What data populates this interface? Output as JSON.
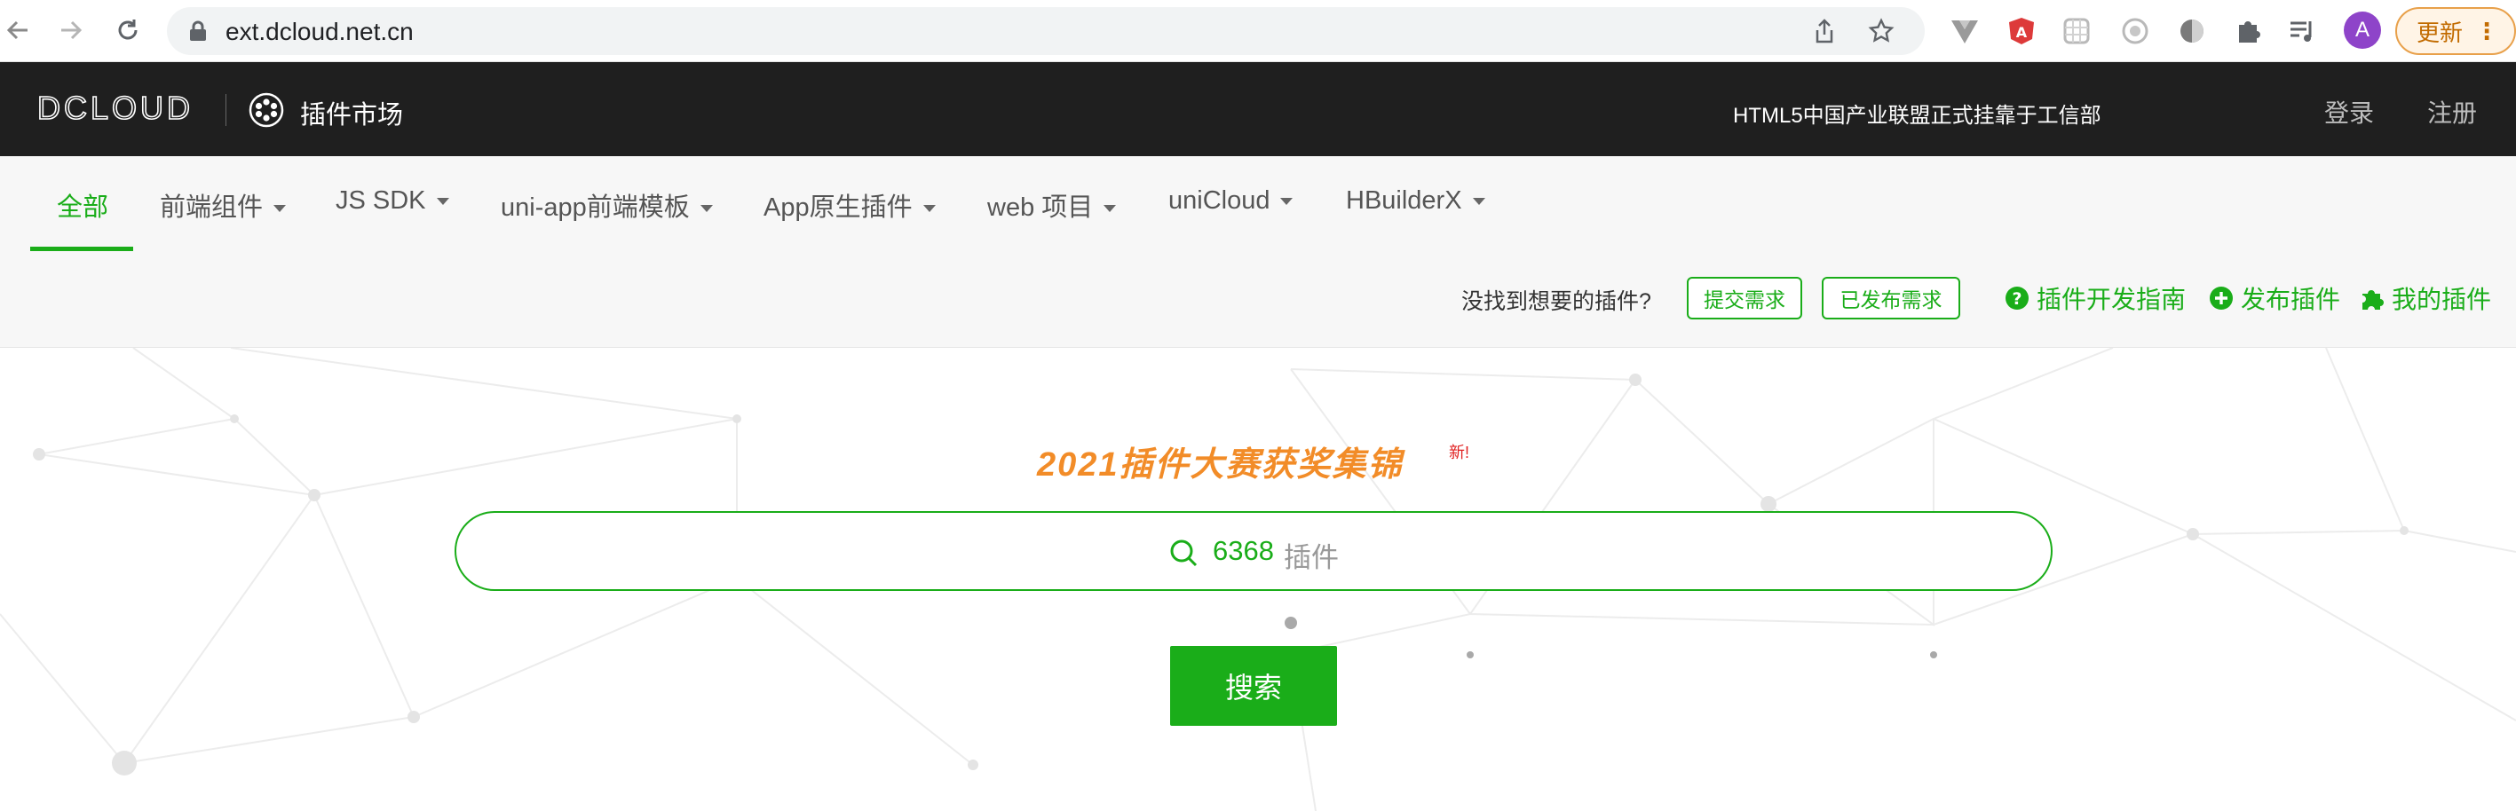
{
  "browser": {
    "url": "ext.dcloud.net.cn",
    "avatar_letter": "A",
    "update_label": "更新"
  },
  "header": {
    "logo_text": "DCLOUD",
    "market_label": "插件市场",
    "notice": "HTML5中国产业联盟正式挂靠于工信部",
    "login": "登录",
    "register": "注册"
  },
  "nav": {
    "tabs": [
      {
        "label": "全部",
        "active": true
      },
      {
        "label": "前端组件"
      },
      {
        "label": "JS SDK"
      },
      {
        "label": "uni-app前端模板"
      },
      {
        "label": "App原生插件"
      },
      {
        "label": "web 项目"
      },
      {
        "label": "uniCloud"
      },
      {
        "label": "HBuilderX"
      }
    ],
    "ask_text": "没找到想要的插件?",
    "submit_request": "提交需求",
    "published_requests": "已发布需求",
    "dev_guide": "插件开发指南",
    "publish_plugin": "发布插件",
    "my_plugins": "我的插件"
  },
  "main": {
    "promo_title": "2021插件大赛获奖集锦",
    "new_badge": "新!",
    "search_count": "6368",
    "search_unit": "插件",
    "search_button": "搜索"
  },
  "colors": {
    "brand_green": "#1aad19",
    "promo_orange": "#f28c28",
    "header_bg": "#1f1f1f"
  }
}
